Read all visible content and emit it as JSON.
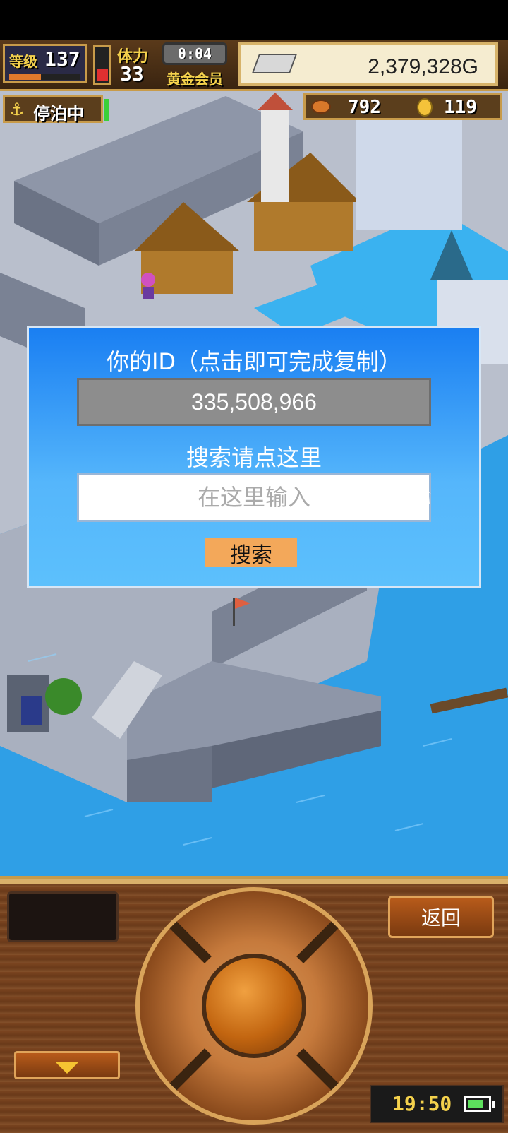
{
  "hud": {
    "level_label": "等级",
    "level_value": "137",
    "level_progress": 0.45,
    "stamina_label": "体力",
    "stamina_value": "33",
    "stamina_level": 0.35,
    "timer": "0:04",
    "member_label": "黄金会员",
    "gold": "2,379,328G",
    "status_label": "停泊中",
    "meat_count": "792",
    "medal_count": "119"
  },
  "dialog": {
    "title": "你的ID（点击即可完成复制）",
    "player_id": "335,508,966",
    "search_hint": "搜索请点这里",
    "input_placeholder": "在这里输入",
    "search_button": "搜索"
  },
  "controls": {
    "back_button": "返回",
    "clock": "19:50",
    "battery_level": 0.8
  },
  "colors": {
    "dialog_top": "#1a7ff2",
    "dialog_bottom": "#5cc0fc",
    "search_button": "#f3a85a",
    "water": "#2f9fe6"
  },
  "icons": [
    "anchor-icon",
    "silver-bar-icon",
    "meat-icon",
    "medal-icon",
    "pointer-hand-icon",
    "down-arrow-icon",
    "battery-icon"
  ]
}
